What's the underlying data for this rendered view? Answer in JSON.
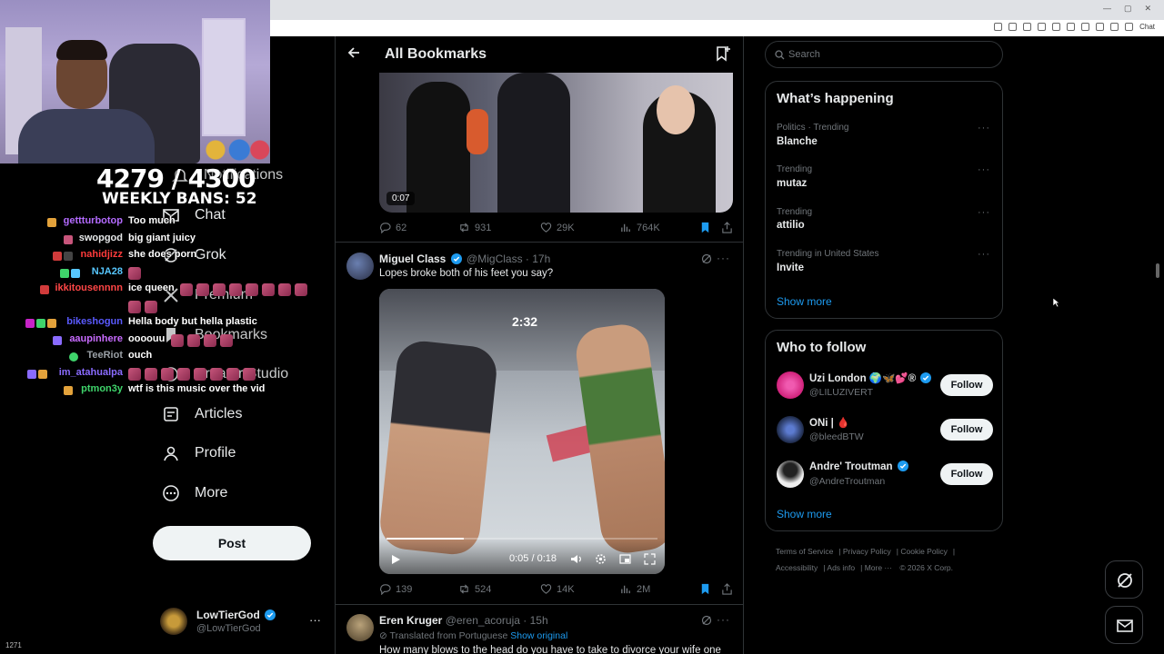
{
  "browser": {
    "chat_label": "Chat"
  },
  "stream_overlay": {
    "counter": "4279 / 4300",
    "bans": "WEEKLY BANS: 52",
    "viewer_count": "1271"
  },
  "chat": [
    {
      "user": "gettturbotop",
      "color": "#b46bff",
      "msg": "Too much"
    },
    {
      "user": "swopgod",
      "color": "#e7e9ea",
      "msg": "big giant juicy"
    },
    {
      "user": "nahidjizz",
      "color": "#ff3b3b",
      "msg": "she does porn"
    },
    {
      "user": "NJA28",
      "color": "#57c7ff",
      "msg": ""
    },
    {
      "user": "ikkitousennnn",
      "color": "#ff4646",
      "msg": "ice queen"
    },
    {
      "user": "bikeshogun",
      "color": "#5a5aff",
      "msg": "Hella body but hella plastic"
    },
    {
      "user": "aaupinhere",
      "color": "#c86bff",
      "msg": "oooouu"
    },
    {
      "user": "TeeRiot",
      "color": "#9aa0a6",
      "msg": "ouch"
    },
    {
      "user": "im_atahualpa",
      "color": "#8a6bff",
      "msg": ""
    },
    {
      "user": "ptmon3y",
      "color": "#3fd46b",
      "msg": "wtf is this music over the vid"
    }
  ],
  "nav": {
    "notifications": "Notifications",
    "chat": "Chat",
    "grok": "Grok",
    "premium": "Premium",
    "bookmarks": "Bookmarks",
    "studio": "Creator Studio",
    "articles": "Articles",
    "profile": "Profile",
    "more": "More",
    "post": "Post"
  },
  "account": {
    "name": "LowTierGod",
    "handle": "@LowTierGod"
  },
  "header": {
    "title": "All Bookmarks"
  },
  "tweets": [
    {
      "video_time": "0:07",
      "replies": "62",
      "reposts": "931",
      "likes": "29K",
      "views": "764K"
    },
    {
      "name": "Miguel Class",
      "handle": "@MigClass",
      "time": "· 17h",
      "text": "Lopes broke both of his feet you say?",
      "overlay_timer": "2:32",
      "video_progress": "0:05 / 0:18",
      "replies": "139",
      "reposts": "524",
      "likes": "14K",
      "views": "2M"
    },
    {
      "name": "Eren Kruger",
      "handle": "@eren_acoruja",
      "time": "· 15h",
      "translated": "Translated from Portuguese",
      "show_original": "Show original",
      "text": "How many blows to the head do you have to take to divorce your wife one"
    }
  ],
  "search": {
    "placeholder": "Search"
  },
  "trends": {
    "title": "What’s happening",
    "items": [
      {
        "meta": "Politics · Trending",
        "topic": "Blanche"
      },
      {
        "meta": "Trending",
        "topic": "mutaz"
      },
      {
        "meta": "Trending",
        "topic": "attilio"
      },
      {
        "meta": "Trending in United States",
        "topic": "Invite"
      }
    ],
    "show_more": "Show more"
  },
  "who_to_follow": {
    "title": "Who to follow",
    "items": [
      {
        "name": "Uzi London 🌍🦋💕®",
        "handle": "@LILUZIVERT",
        "button": "Follow",
        "avatar_color": "#d0217a"
      },
      {
        "name": "ONi | 🩸",
        "handle": "@bleedBTW",
        "button": "Follow",
        "avatar_color": "#2c3d66"
      },
      {
        "name": "Andre' Troutman",
        "handle": "@AndreTroutman",
        "button": "Follow",
        "avatar_color": "#e6e6e6"
      }
    ],
    "show_more": "Show more"
  },
  "footer": {
    "links": [
      "Terms of Service",
      "Privacy Policy",
      "Cookie Policy",
      "Accessibility",
      "Ads info",
      "More ···",
      "© 2026 X Corp."
    ]
  },
  "colors": {
    "accent": "#1d9bf0",
    "background": "#000000",
    "border": "#2f3336",
    "muted": "#71767b"
  }
}
